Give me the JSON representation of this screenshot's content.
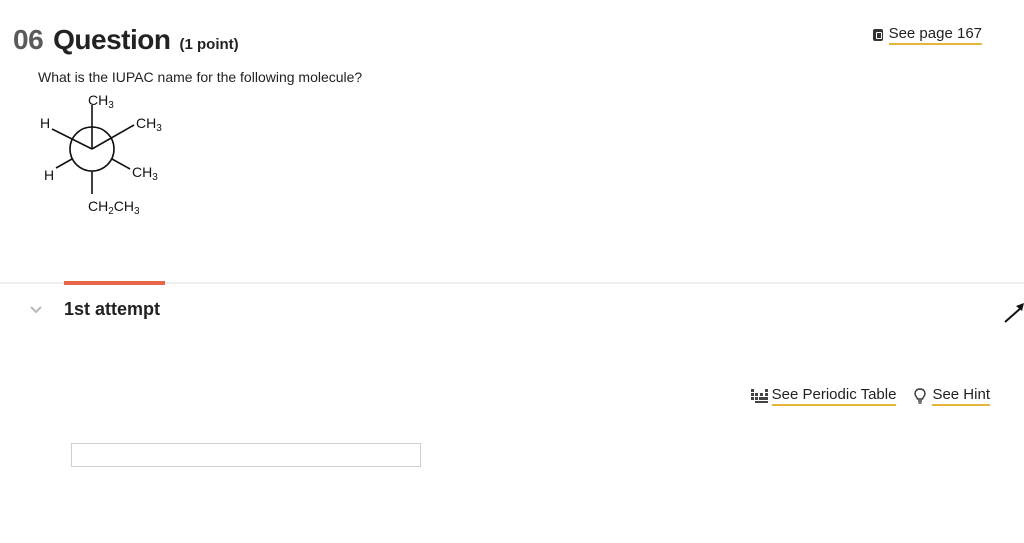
{
  "question": {
    "number": "06",
    "title": "Question",
    "points": "(1 point)",
    "prompt": "What is the IUPAC name for the following molecule?"
  },
  "reference": {
    "label": "See page 167",
    "icon": "book-icon"
  },
  "molecule": {
    "top": "CH3",
    "front_left": "H",
    "front_right": "CH3",
    "back_left": "H",
    "back_right": "CH3",
    "bottom": "CH2CH3"
  },
  "attempt": {
    "label": "1st attempt",
    "accent_color": "#e8664a"
  },
  "tools": {
    "periodic_table": {
      "label": "See Periodic Table",
      "icon": "periodic-table-icon"
    },
    "hint": {
      "label": "See Hint",
      "icon": "lightbulb-icon"
    },
    "link_underline_color": "#e6b53c"
  },
  "answer": {
    "value": "",
    "placeholder": ""
  }
}
